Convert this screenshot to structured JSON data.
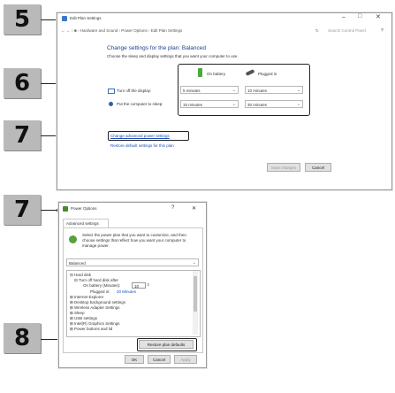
{
  "steps": {
    "s5": "5",
    "s6": "6",
    "s7a": "7",
    "s7b": "7",
    "s8": "8"
  },
  "plan_window": {
    "title": "Edit Plan Settings",
    "breadcrumb": "←  →  ↑  ■ › Hardware and Sound › Power Options › Edit Plan Settings",
    "search_placeholder": "Search Control Panel",
    "heading": "Change settings for the plan: Balanced",
    "subheading": "Choose the sleep and display settings that you want your computer to use.",
    "col_battery": "On battery",
    "col_plugged": "Plugged in",
    "rows": [
      {
        "label": "Turn off the display:",
        "battery": "5 minutes",
        "plugged": "10 minutes"
      },
      {
        "label": "Put the computer to sleep:",
        "battery": "15 minutes",
        "plugged": "30 minutes"
      }
    ],
    "link_advanced": "Change advanced power settings",
    "link_restore": "Restore default settings for this plan",
    "save_label": "Save changes",
    "cancel_label": "Cancel"
  },
  "power_options": {
    "title": "Power Options",
    "help": "?",
    "close": "✕",
    "tab": "Advanced settings",
    "description": "Select the power plan that you want to customize, and then choose settings that reflect how you want your computer to manage power.",
    "plan_select": "Balanced",
    "tree": [
      {
        "text": "⊟ Hard disk",
        "indent": 0
      },
      {
        "text": "⊟ Turn off hard disk after",
        "indent": 1
      },
      {
        "text": "On battery (Minutes):",
        "indent": 2
      },
      {
        "text": "Plugged in:",
        "indent": 2
      },
      {
        "text": "⊞ Internet Explorer",
        "indent": 0
      },
      {
        "text": "⊞ Desktop background settings",
        "indent": 0
      },
      {
        "text": "⊞ Wireless Adapter Settings",
        "indent": 0
      },
      {
        "text": "⊞ Sleep",
        "indent": 0
      },
      {
        "text": "⊞ USB settings",
        "indent": 0
      },
      {
        "text": "⊞ Intel(R) Graphics Settings",
        "indent": 0
      },
      {
        "text": "⊞ Power buttons and lid",
        "indent": 0
      }
    ],
    "battery_minutes": "10",
    "plugged_value": "20 Minutes",
    "restore_label": "Restore plan defaults",
    "ok_label": "OK",
    "cancel_label": "Cancel",
    "apply_label": "Apply"
  }
}
